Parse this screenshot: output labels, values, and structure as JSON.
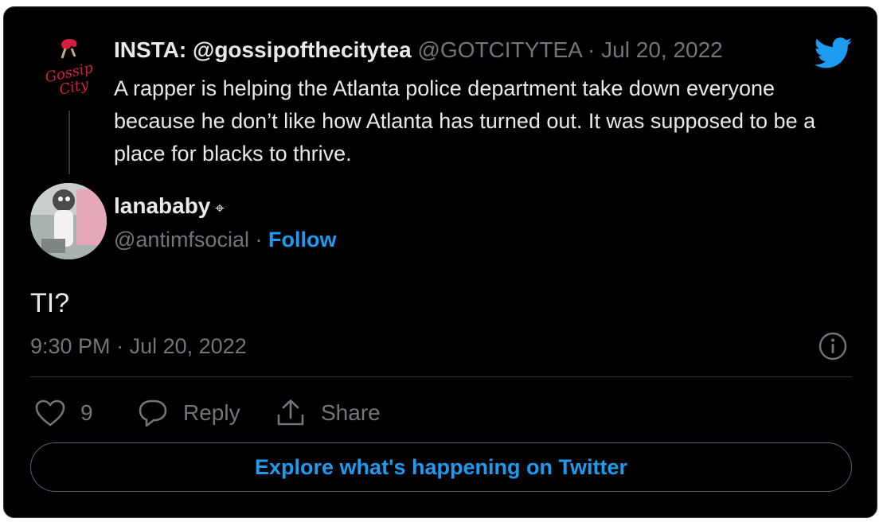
{
  "quoted_tweet": {
    "author_name": "INSTA: @gossipofthecitytea",
    "author_handle": "@GOTCITYTEA",
    "separator": "·",
    "date": "Jul 20, 2022",
    "text": "A rapper is helping the Atlanta police department take down everyone because he don’t like how Atlanta has turned out. It was supposed to be a place for blacks to thrive.",
    "avatar_text_line1": "Gossip",
    "avatar_text_line2": "City"
  },
  "tweet": {
    "author_name": "lanababy",
    "name_badge": "⌖",
    "author_handle": "@antimfsocial",
    "separator": "·",
    "follow_label": "Follow",
    "text": "TI?",
    "time": "9:30 PM",
    "date": "Jul 20, 2022"
  },
  "actions": {
    "like_count": "9",
    "reply_label": "Reply",
    "share_label": "Share"
  },
  "explore_label": "Explore what's happening on Twitter",
  "icons": {
    "brand": "twitter-bird-icon",
    "info": "info-icon",
    "like": "heart-icon",
    "reply": "speech-bubble-icon",
    "share": "share-upload-icon"
  },
  "colors": {
    "background": "#000000",
    "text_primary": "#e7e9ea",
    "text_muted": "#71767b",
    "accent": "#1d9bf0",
    "twitter_brand": "#1d9bf0",
    "border": "#2f3336",
    "quoted_avatar_accent": "#d31f3c"
  }
}
